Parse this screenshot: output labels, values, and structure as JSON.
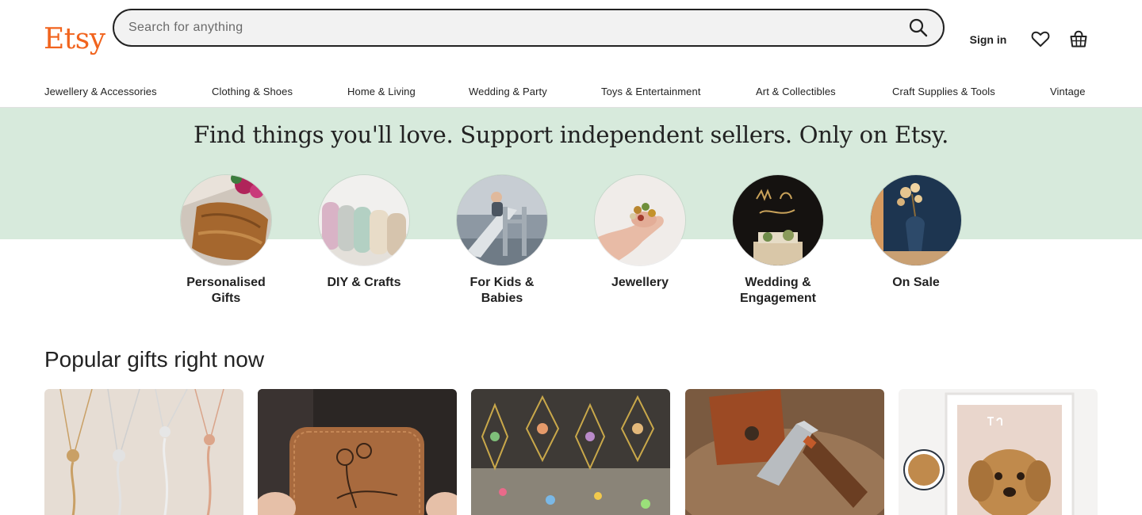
{
  "header": {
    "logo": "Etsy",
    "search_placeholder": "Search for anything",
    "sign_in": "Sign in"
  },
  "categories": [
    "Jewellery & Accessories",
    "Clothing & Shoes",
    "Home & Living",
    "Wedding & Party",
    "Toys & Entertainment",
    "Art & Collectibles",
    "Craft Supplies & Tools",
    "Vintage"
  ],
  "hero": {
    "title": "Find things you'll love. Support independent sellers. Only on Etsy.",
    "circles": [
      "Personalised Gifts",
      "DIY & Crafts",
      "For Kids & Babies",
      "Jewellery",
      "Wedding & Engagement",
      "On Sale"
    ]
  },
  "popular": {
    "title": "Popular gifts right now"
  },
  "colors": {
    "brand": "#F1641E",
    "hero_bg": "#d7eadc",
    "text": "#222222"
  }
}
